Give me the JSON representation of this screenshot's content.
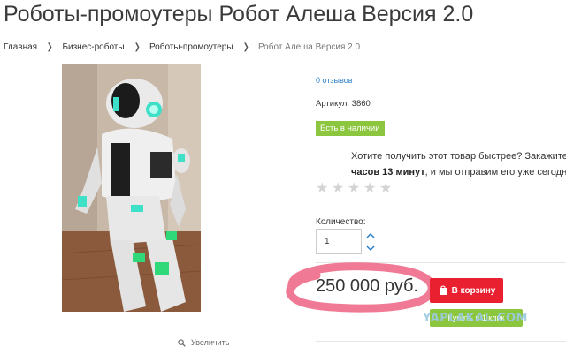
{
  "page": {
    "title": "Роботы-промоутеры Робот Алеша Версия 2.0"
  },
  "breadcrumb": {
    "items": [
      "Главная",
      "Бизнес-роботы",
      "Роботы-промоутеры"
    ],
    "current": "Робот Алеша Версия 2.0"
  },
  "gallery": {
    "zoom_label": "Увеличить"
  },
  "product": {
    "reviews": "0 отзывов",
    "sku": "Артикул: 3860",
    "stock": "Есть в наличии",
    "promo_line1": "Хотите получить этот товар быстрее? Закажите в",
    "promo_bold": "часов 13 минут",
    "promo_rest": ", и мы отправим его уже сегодня",
    "rating": 0,
    "quantity_label": "Количество:",
    "quantity_value": "1",
    "price": "250 000 руб.",
    "cart_button": "В корзину",
    "buy_button": "Купить в 1 клик"
  },
  "colors": {
    "accent_green": "#8cc63f",
    "cart_red": "#e8202f",
    "link_blue": "#2a7fc9",
    "highlight_pink": "#f07a95"
  },
  "watermark": "YAPLAKAL.COM"
}
